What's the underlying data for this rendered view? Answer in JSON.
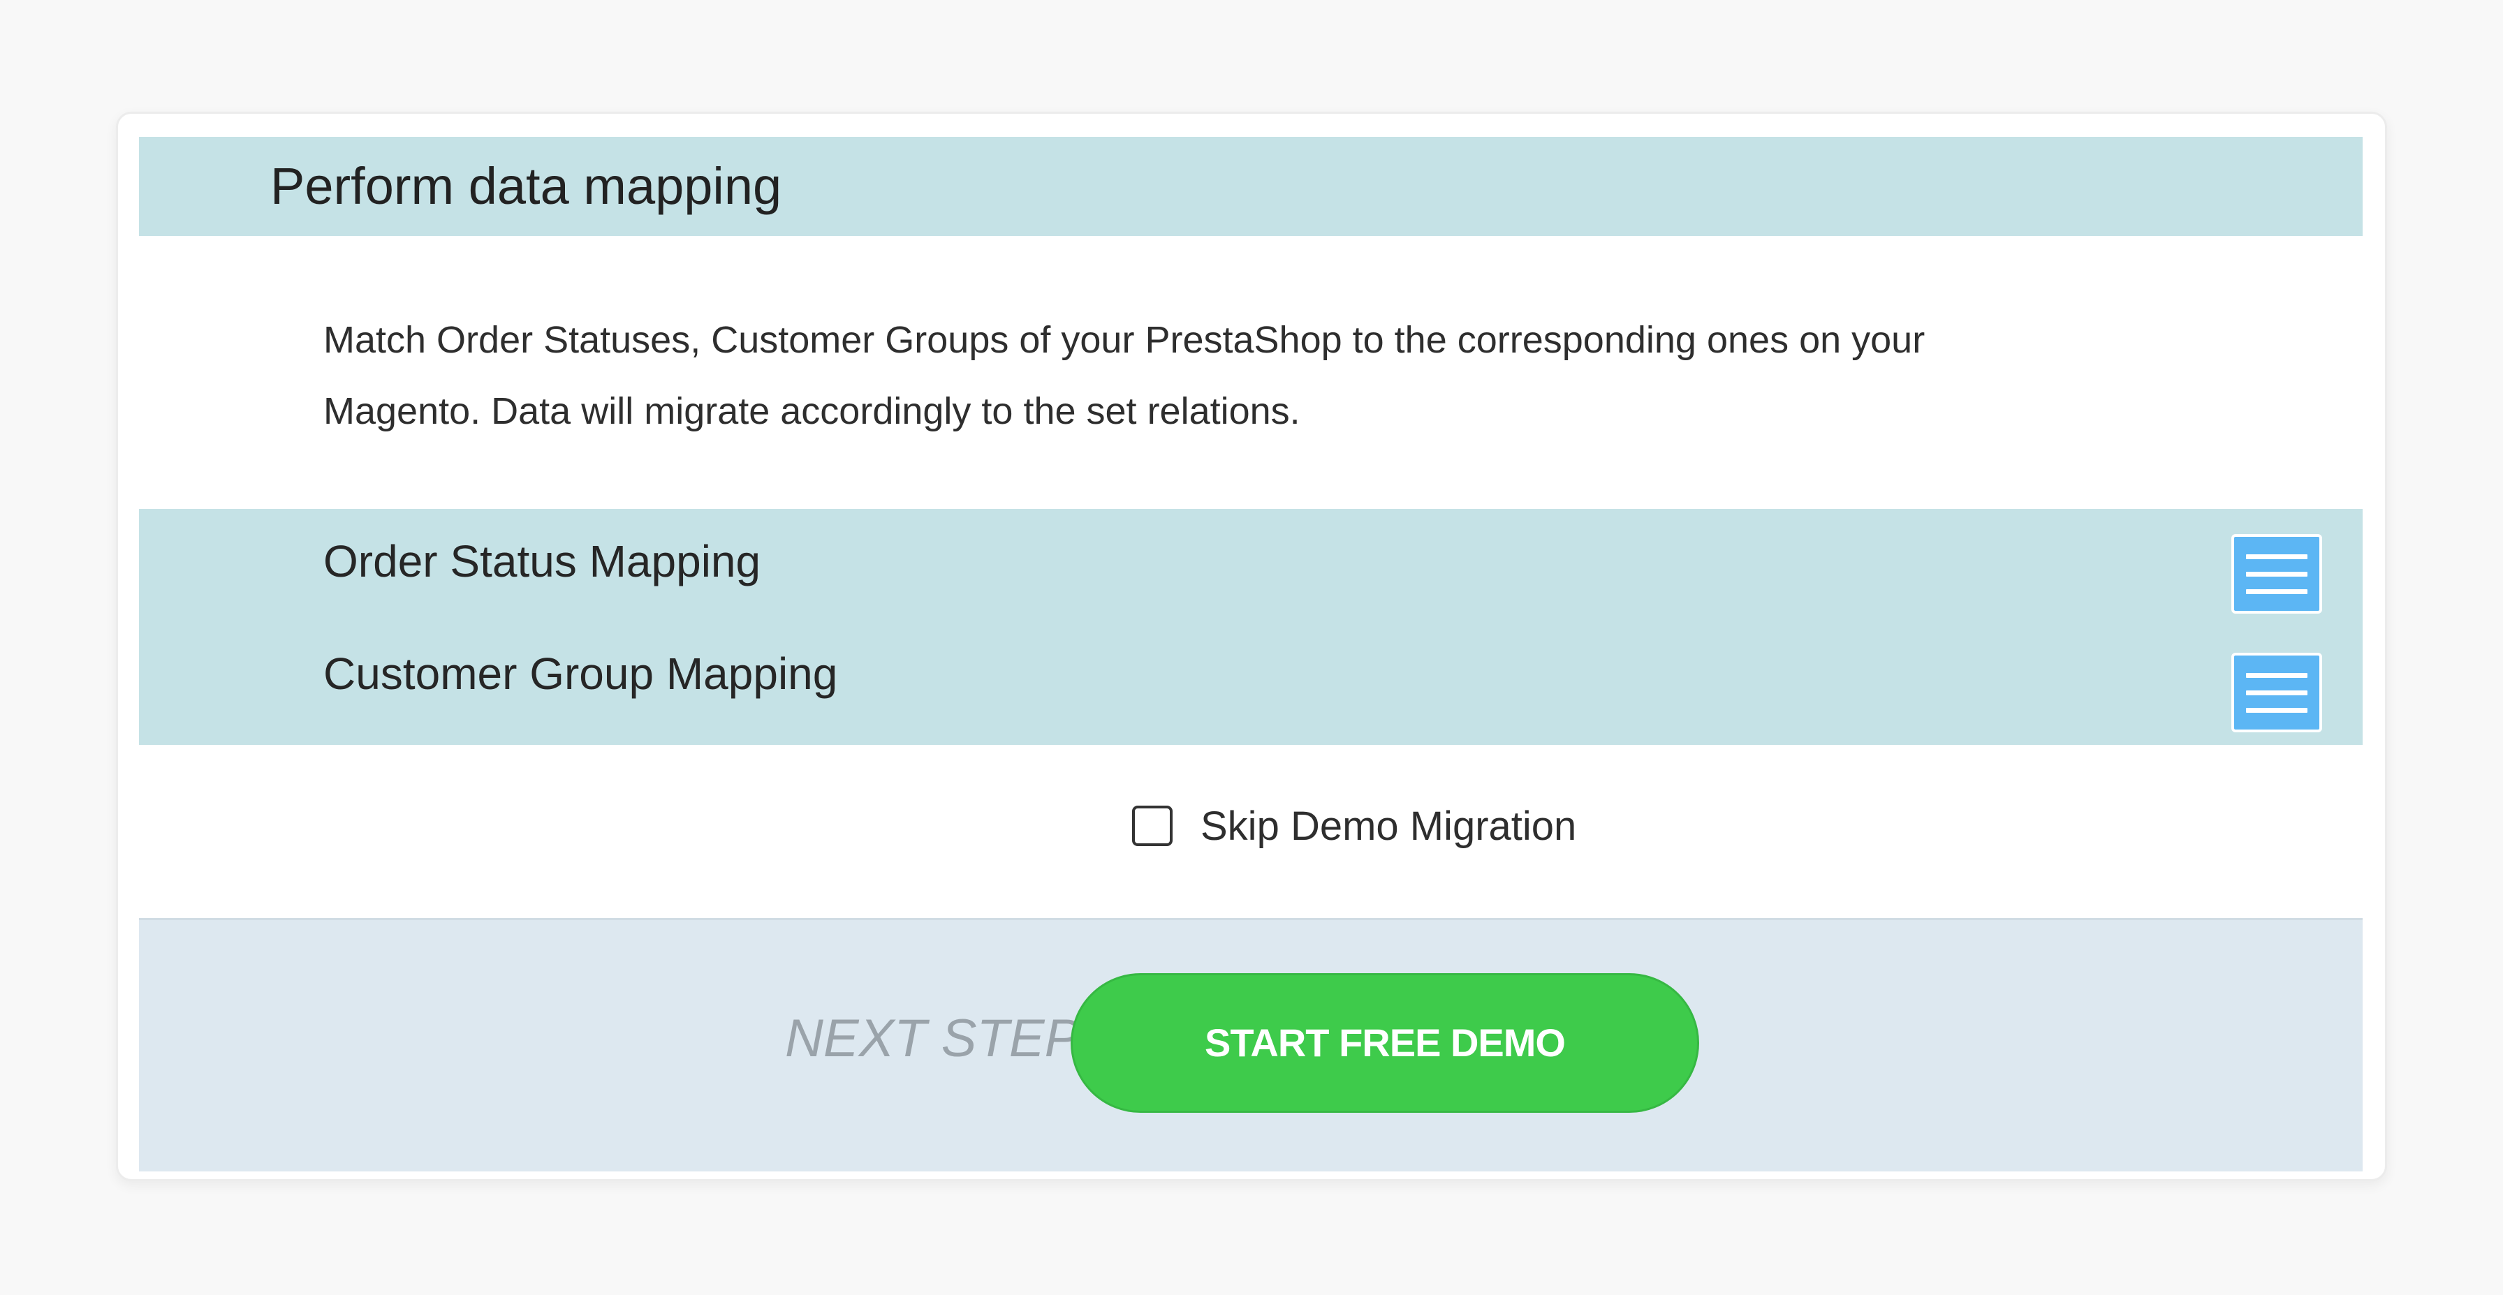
{
  "section": {
    "title": "Perform data mapping"
  },
  "description": {
    "line1": "Match Order Statuses, Customer Groups of your PrestaShop to the corresponding ones on your",
    "line2": "Magento. Data will migrate accordingly to the set relations."
  },
  "mappings": [
    {
      "label": "Order Status Mapping",
      "icon": "menu-icon"
    },
    {
      "label": "Customer Group Mapping",
      "icon": "menu-icon"
    }
  ],
  "skip_demo": {
    "label": "Skip Demo Migration",
    "checked": false
  },
  "footer": {
    "next_step_label": "NEXT STEP",
    "start_button_label": "START FREE DEMO"
  },
  "colors": {
    "header_bg": "#c5e2e6",
    "footer_bg": "#dde8f0",
    "accent_button": "#3ecb4b",
    "menu_button": "#5cb6f4"
  }
}
